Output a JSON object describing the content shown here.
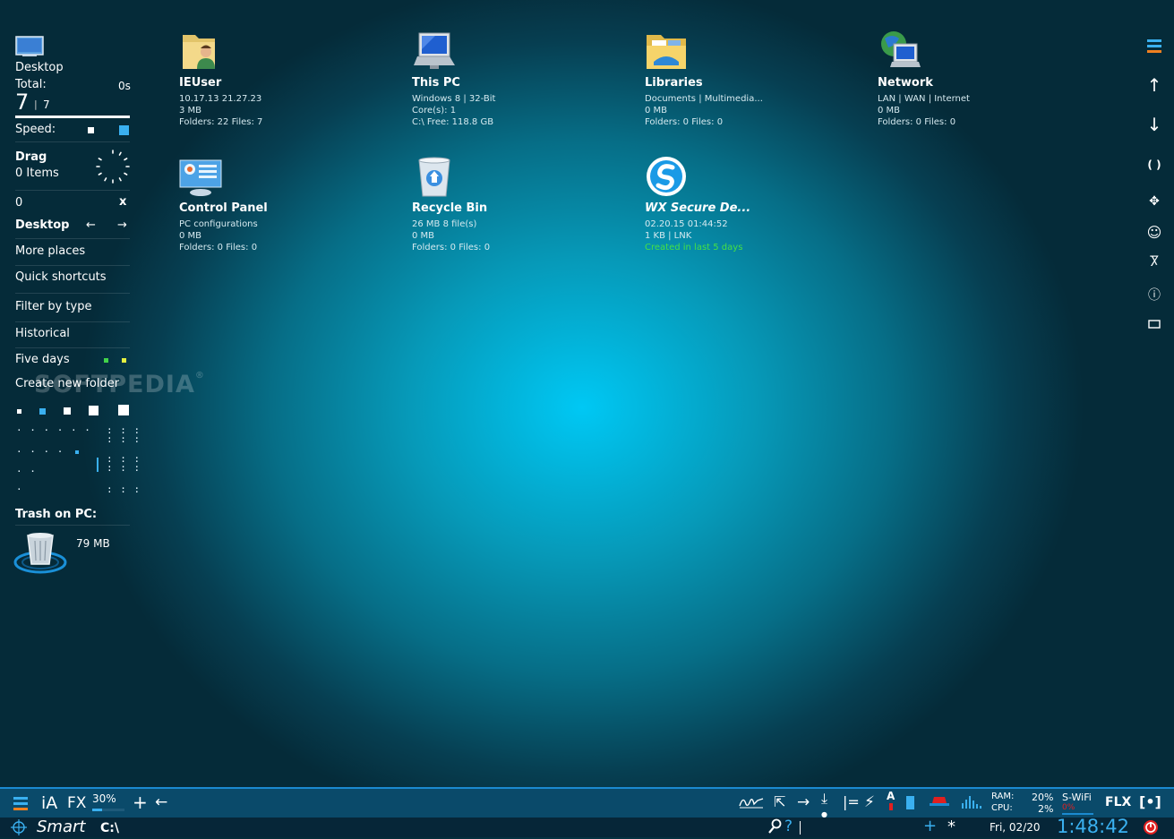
{
  "left_panel": {
    "desktop_label": "Desktop",
    "total_label": "Total:",
    "total_time": "0s",
    "count_big": "7",
    "count_sep": "|",
    "count_small": "7",
    "speed_label": "Speed:",
    "drag_label": "Drag",
    "drag_items": "0 Items",
    "zero_value": "0",
    "close_glyph": "x",
    "nav_label": "Desktop",
    "menu": [
      "More places",
      "Quick shortcuts",
      "Filter by type",
      "Historical",
      "Five days",
      "Create new folder"
    ],
    "trash_label": "Trash on PC:",
    "trash_size": "79 MB"
  },
  "desktop_icons": [
    {
      "name": "IEUser",
      "icon": "user-folder-icon",
      "lines": [
        "10.17.13  21.27.23",
        "3 MB",
        "Folders: 22  Files: 7"
      ]
    },
    {
      "name": "This PC",
      "icon": "computer-icon",
      "lines": [
        "Windows 8 | 32-Bit",
        "Core(s): 1",
        "C:\\  Free: 118.8 GB"
      ]
    },
    {
      "name": "Libraries",
      "icon": "libraries-folder-icon",
      "lines": [
        "Documents | Multimedia...",
        "0 MB",
        "Folders: 0  Files: 0"
      ]
    },
    {
      "name": "Network",
      "icon": "network-globe-icon",
      "lines": [
        "LAN | WAN | Internet",
        "0 MB",
        "Folders: 0  Files: 0"
      ]
    },
    {
      "name": "Control Panel",
      "icon": "control-panel-icon",
      "lines": [
        "PC configurations",
        "0 MB",
        "Folders: 0  Files: 0"
      ]
    },
    {
      "name": "Recycle Bin",
      "icon": "recycle-bin-icon",
      "lines": [
        "26 MB  8 file(s)",
        "0 MB",
        "Folders: 0  Files: 0"
      ]
    },
    {
      "name": "WX Secure De...",
      "icon": "wx-secure-icon",
      "lines": [
        "02.20.15  01:44:52",
        "1 KB  |  LNK",
        "Created in last 5 days"
      ]
    }
  ],
  "watermark": "SOFTPEDIA",
  "watermark_mark": "®",
  "taskbar": {
    "ia_label": "iA",
    "fx_label": "FX",
    "percent": "30%",
    "percent_value": 30,
    "plus_glyph": "+",
    "back_glyph": "←",
    "a_glyph": "A",
    "ram_label": "RAM:",
    "ram_value": "20%",
    "cpu_label": "CPU:",
    "cpu_value": "2%",
    "wifi_label": "S-WiFi",
    "wifi_value": "0%",
    "flx_label": "FLX",
    "bracket_label": "[•]"
  },
  "bottom_bar": {
    "smart_label": "Smart",
    "path": "C:\\",
    "question": "?",
    "plus_glyph": "+",
    "asterisk": "*",
    "date": "Fri, 02/20",
    "time": "1:48:42"
  },
  "colors": {
    "accent": "#1b8ad0",
    "highlight": "#3ab0f0",
    "orange": "#f08020",
    "green_text": "#45e045",
    "alert_red": "#e02020"
  }
}
